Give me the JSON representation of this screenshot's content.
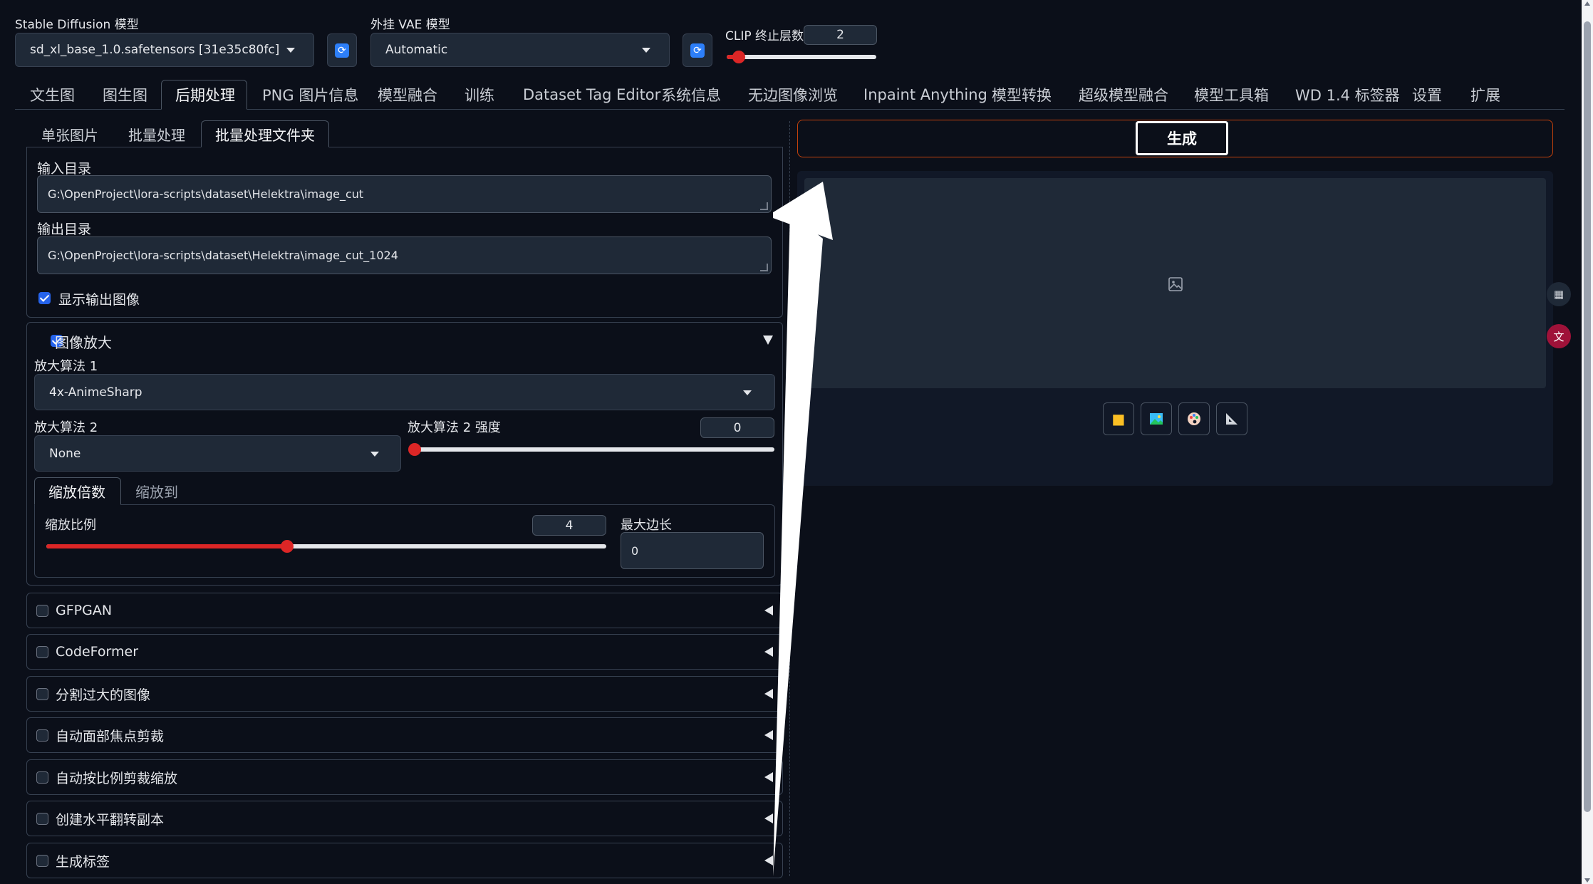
{
  "top": {
    "sd_model_label": "Stable Diffusion 模型",
    "sd_model_value": "sd_xl_base_1.0.safetensors [31e35c80fc]",
    "vae_label": "外挂 VAE 模型",
    "vae_value": "Automatic",
    "clip_label": "CLIP 终止层数",
    "clip_value": "2",
    "clip_level": 0.08
  },
  "main_tabs": [
    "文生图",
    "图生图",
    "后期处理",
    "PNG 图片信息",
    "模型融合",
    "训练",
    "Dataset Tag Editor",
    "系统信息",
    "无边图像浏览",
    "Inpaint Anything",
    "模型转换",
    "超级模型融合",
    "模型工具箱",
    "WD 1.4 标签器",
    "设置",
    "扩展"
  ],
  "sub_tabs": [
    "单张图片",
    "批量处理",
    "批量处理文件夹"
  ],
  "batch": {
    "input_label": "输入目录",
    "input_value": "G:\\OpenProject\\lora-scripts\\dataset\\Helektra\\image_cut",
    "output_label": "输出目录",
    "output_value": "G:\\OpenProject\\lora-scripts\\dataset\\Helektra\\image_cut_1024",
    "show_output_label": "显示输出图像"
  },
  "upscale": {
    "title": "图像放大",
    "upscaler1_label": "放大算法 1",
    "upscaler1_value": "4x-AnimeSharp",
    "upscaler2_label": "放大算法 2",
    "upscaler2_value": "None",
    "strength_label": "放大算法 2 强度",
    "strength_value": "0",
    "strength_level": 0.0,
    "resize_tabs": [
      "缩放倍数",
      "缩放到"
    ],
    "scale_label": "缩放比例",
    "scale_value": "4",
    "scale_level": 0.43,
    "max_side_label": "最大边长",
    "max_side_value": "0"
  },
  "accordions": [
    "GFPGAN",
    "CodeFormer",
    "分割过大的图像",
    "自动面部焦点剪裁",
    "自动按比例剪裁缩放",
    "创建水平翻转副本",
    "生成标签"
  ],
  "right": {
    "generate_label": "生成"
  },
  "colors": {
    "background": "#0b0f19",
    "panel": "#1f2937",
    "accent": "#dc2626",
    "checkbox": "#2563eb",
    "generate_border": "#c2410c"
  },
  "icons": [
    "refresh-icon",
    "image-placeholder-icon",
    "folder-icon",
    "send-to-img2img-icon",
    "palette-icon",
    "ruler-icon",
    "qr-icon",
    "translate-icon"
  ]
}
